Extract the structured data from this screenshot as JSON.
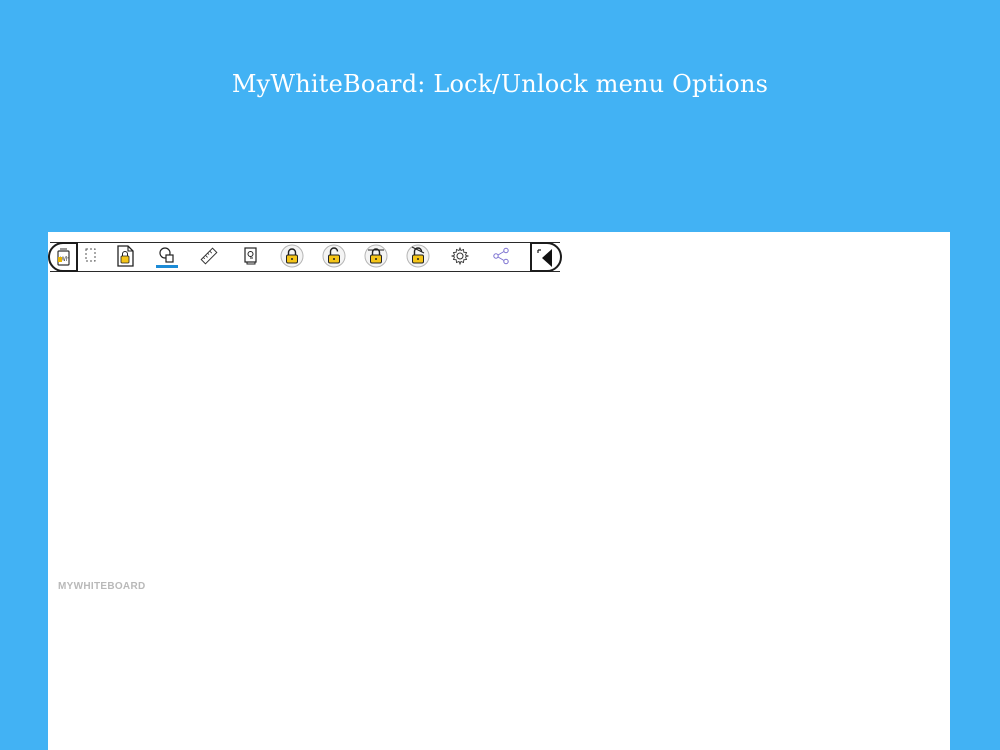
{
  "headline": "MyWhiteBoard: Lock/Unlock menu Options",
  "watermark": "MYWHITEBOARD",
  "toolbar": {
    "tools": [
      {
        "name": "app-logo-icon"
      },
      {
        "name": "select-icon"
      },
      {
        "name": "document-lock-icon"
      },
      {
        "name": "shapes-icon",
        "active": true
      },
      {
        "name": "ruler-icon"
      },
      {
        "name": "stamp-icon"
      },
      {
        "name": "lock-icon"
      },
      {
        "name": "unlock-icon"
      },
      {
        "name": "lock-all-icon"
      },
      {
        "name": "unlock-all-icon"
      },
      {
        "name": "settings-icon"
      },
      {
        "name": "share-icon"
      },
      {
        "name": "collapse-toolbar-icon"
      }
    ]
  },
  "colors": {
    "background": "#42b2f4",
    "accent": "#1c8bd6",
    "lock_yellow": "#f5c518",
    "share": "#7a6fd0"
  }
}
